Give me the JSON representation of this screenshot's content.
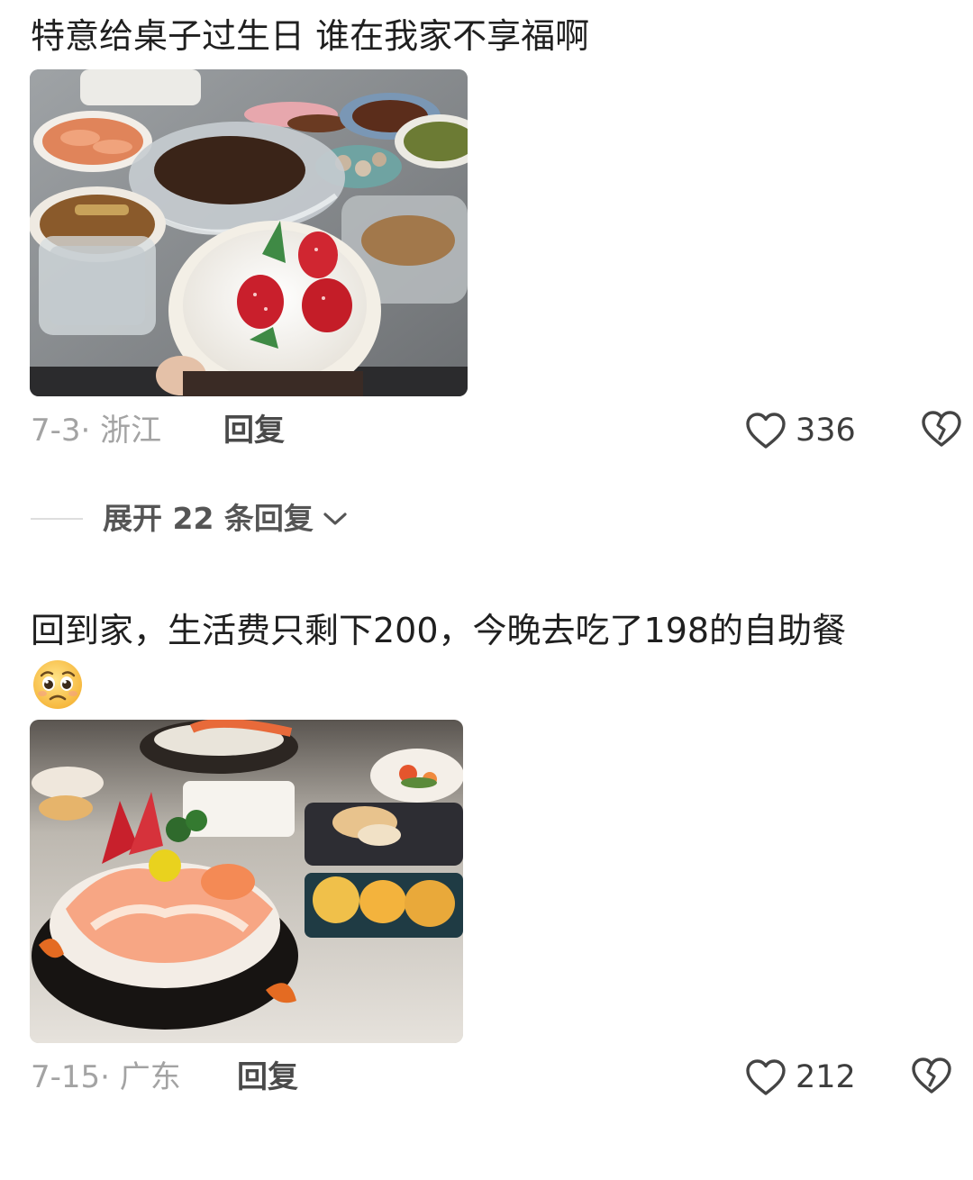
{
  "comments": [
    {
      "text": "特意给桌子过生日 谁在我家不享福啊",
      "image_subject": "birthday cake on table with seafood and snacks",
      "date_location": "7-3· 浙江",
      "reply_label": "回复",
      "likes": "336",
      "expand_label": "展开 22 条回复"
    },
    {
      "text": "回到家，生活费只剩下200，今晚去吃了198的自助餐",
      "emoji": "pleading-face",
      "image_subject": "sashimi platter and buffet dishes",
      "date_location": "7-15· 广东",
      "reply_label": "回复",
      "likes": "212"
    }
  ],
  "icons": {
    "like": "heart-outline-icon",
    "dislike": "broken-heart-icon",
    "expand": "chevron-down-icon"
  },
  "colors": {
    "text": "#1f1f1f",
    "meta": "#a3a3a3",
    "reply": "#4a4a4a",
    "icon": "#444444"
  }
}
